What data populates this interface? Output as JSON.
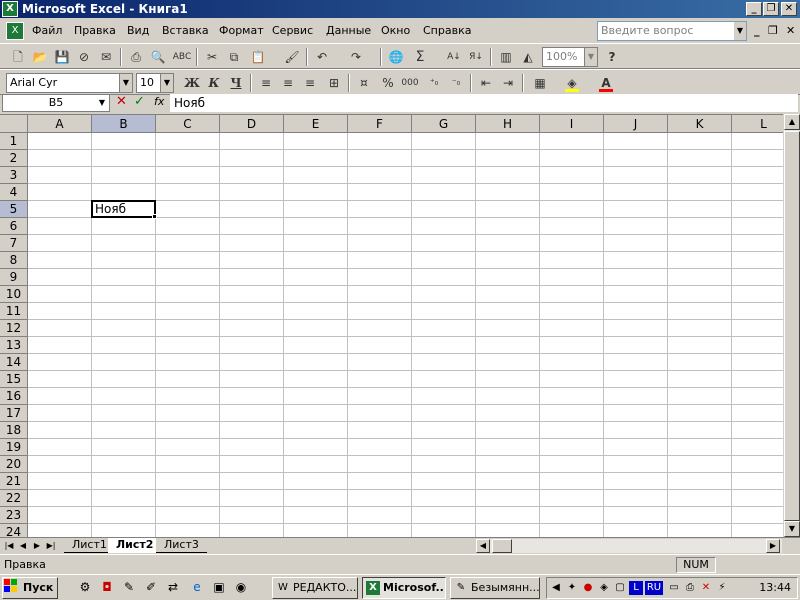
{
  "window": {
    "title": "Microsoft Excel - Книга1",
    "app_icon": "excel-icon"
  },
  "menu": {
    "items": [
      "Файл",
      "Правка",
      "Вид",
      "Вставка",
      "Формат",
      "Сервис",
      "Данные",
      "Окно",
      "Справка"
    ],
    "help_placeholder": "Введите вопрос"
  },
  "toolbar_standard": {
    "icons": [
      "new-icon",
      "open-icon",
      "save-icon",
      "permission-icon",
      "email-icon",
      "print-icon",
      "print-preview-icon",
      "spelling-icon",
      "cut-icon",
      "copy-icon",
      "paste-icon",
      "format-painter-icon",
      "undo-icon",
      "redo-icon",
      "hyperlink-icon",
      "autosum-icon",
      "sort-ascending-icon",
      "sort-descending-icon",
      "chart-wizard-icon",
      "drawing-icon",
      "help-icon"
    ],
    "zoom": "100%"
  },
  "toolbar_format": {
    "font": "Arial Cyr",
    "size": "10",
    "bold": "Ж",
    "italic": "К",
    "underline": "Ч",
    "icons": [
      "align-left-icon",
      "align-center-icon",
      "align-right-icon",
      "merge-center-icon",
      "currency-icon",
      "percent-icon",
      "thousands-icon",
      "increase-decimal-icon",
      "decrease-decimal-icon",
      "decrease-indent-icon",
      "increase-indent-icon",
      "borders-icon",
      "fill-color-icon",
      "font-color-icon"
    ],
    "percent_label": "%",
    "thousands_label": "000"
  },
  "formula_bar": {
    "name_box": "B5",
    "cancel": "✕",
    "enter": "✓",
    "fx": "fx",
    "value": "Нояб"
  },
  "grid": {
    "columns": [
      "A",
      "B",
      "C",
      "D",
      "E",
      "F",
      "G",
      "H",
      "I",
      "J",
      "K",
      "L"
    ],
    "rows": [
      "1",
      "2",
      "3",
      "4",
      "5",
      "6",
      "7",
      "8",
      "9",
      "10",
      "11",
      "12",
      "13",
      "14",
      "15",
      "16",
      "17",
      "18",
      "19",
      "20",
      "21",
      "22",
      "23",
      "24"
    ],
    "active_cell": {
      "ref": "B5",
      "value": "Нояб"
    }
  },
  "sheets": {
    "tabs": [
      "Лист1",
      "Лист2",
      "Лист3"
    ],
    "active": "Лист2"
  },
  "status": {
    "text": "Правка",
    "num": "NUM"
  },
  "taskbar": {
    "start": "Пуск",
    "tasks": [
      {
        "label": "РЕДАКТО...",
        "icon": "word-icon",
        "active": false
      },
      {
        "label": "Microsof...",
        "icon": "excel-icon",
        "active": true
      },
      {
        "label": "Безымянн...",
        "icon": "paint-icon",
        "active": false
      }
    ],
    "tray_lang": "RU",
    "clock": "13:44"
  }
}
